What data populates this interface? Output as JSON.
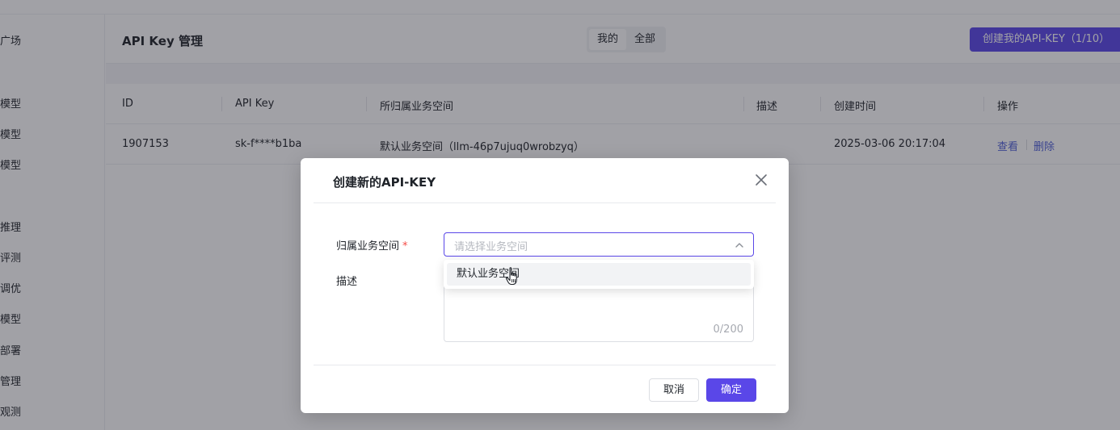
{
  "sidebar": {
    "items": [
      {
        "label": "广场"
      },
      {
        "label": "模型"
      },
      {
        "label": "模型"
      },
      {
        "label": "模型"
      },
      {
        "label": "推理"
      },
      {
        "label": "评测"
      },
      {
        "label": "调优"
      },
      {
        "label": "模型"
      },
      {
        "label": "部署"
      },
      {
        "label": "管理"
      },
      {
        "label": "观测"
      }
    ]
  },
  "header": {
    "title": "API Key 管理",
    "tabs": [
      {
        "label": "我的",
        "active": true
      },
      {
        "label": "全部",
        "active": false
      }
    ],
    "create_button": "创建我的API-KEY（1/10）"
  },
  "table": {
    "columns": [
      "ID",
      "API Key",
      "所归属业务空间",
      "描述",
      "创建时间",
      "操作"
    ],
    "rows": [
      {
        "id": "1907153",
        "api_key": "sk-f****b1ba",
        "workspace": "默认业务空间（llm-46p7ujuq0wrobzyq）",
        "description": "",
        "created_at": "2025-03-06 20:17:04",
        "actions": {
          "view": "查看",
          "delete": "删除"
        }
      }
    ]
  },
  "modal": {
    "title": "创建新的API-KEY",
    "close_icon": "close-icon",
    "workspace_label": "归属业务空间",
    "required_mark": "*",
    "workspace_placeholder": "请选择业务空间",
    "dropdown_options": [
      "默认业务空间"
    ],
    "description_label": "描述",
    "description_counter": "0/200",
    "cancel_label": "取消",
    "confirm_label": "确定"
  },
  "colors": {
    "accent": "#5a47e8",
    "link": "#4f5fd8",
    "required": "#f54a45",
    "overlay": "rgba(30,32,44,0.42)"
  }
}
